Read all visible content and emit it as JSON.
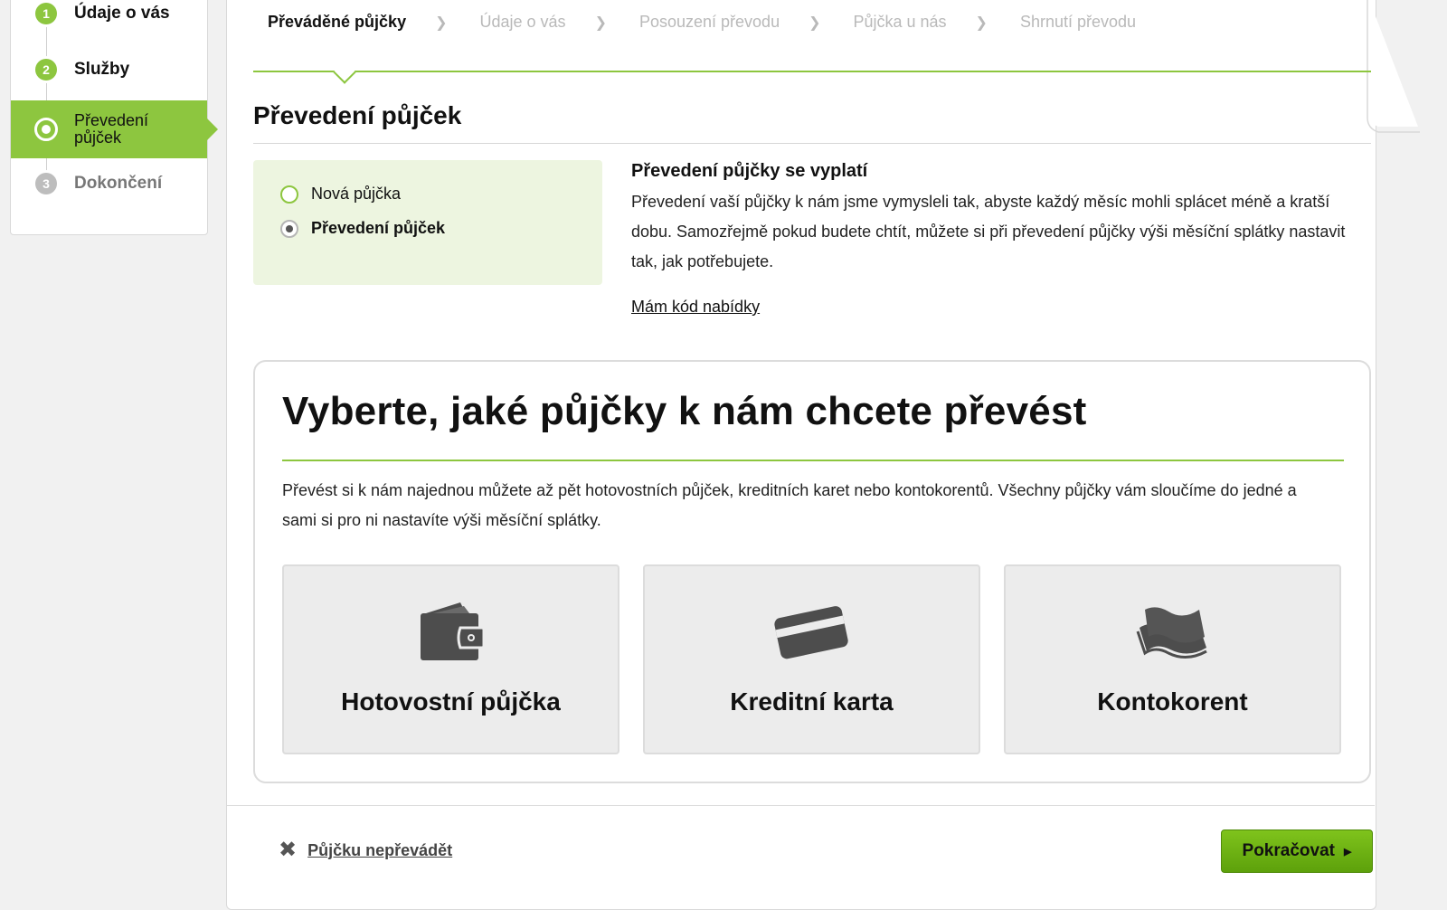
{
  "sidebar": {
    "steps": [
      {
        "number": "1",
        "label": "Údaje o vás",
        "state": "done"
      },
      {
        "number": "2",
        "label": "Služby",
        "state": "done"
      },
      {
        "number": "",
        "label": "Převedení půjček",
        "state": "current"
      },
      {
        "number": "3",
        "label": "Dokončení",
        "state": "pending"
      }
    ]
  },
  "breadcrumbs": {
    "items": [
      "Převáděné půjčky",
      "Údaje o vás",
      "Posouzení převodu",
      "Půjčka u nás",
      "Shrnutí převodu"
    ],
    "active_index": 0
  },
  "section": {
    "title": "Převedení půjček"
  },
  "loan_type": {
    "options": [
      {
        "label": "Nová půjčka",
        "selected": false
      },
      {
        "label": "Převedení půjček",
        "selected": true
      }
    ]
  },
  "info": {
    "heading": "Převedení půjčky se vyplatí",
    "text": "Převedení vaší půjčky k nám jsme vymysleli tak, abyste každý měsíc mohli splácet méně a kratší dobu. Samozřejmě pokud budete chtít, můžete si při převedení půjčky výši měsíční splátky nastavit tak, jak potřebujete.",
    "offer_code_link": "Mám kód nabídky"
  },
  "panel": {
    "title": "Vyberte, jaké půjčky k nám chcete převést",
    "description": "Převést si k nám najednou můžete až pět hotovostních půjček, kreditních karet nebo kontokorentů. Všechny půjčky vám sloučíme do jedné a sami si pro ni nastavíte výši měsíční splátky.",
    "tiles": [
      {
        "label": "Hotovostní půjčka",
        "icon": "wallet-icon"
      },
      {
        "label": "Kreditní karta",
        "icon": "credit-card-icon"
      },
      {
        "label": "Kontokorent",
        "icon": "banknotes-icon"
      }
    ]
  },
  "footer": {
    "skip_label": "Půjčku nepřevádět",
    "continue_label": "Pokračovat"
  },
  "colors": {
    "accent": "#8dc63f",
    "panel_bg": "#edf5e0",
    "button": "#6ab114"
  }
}
